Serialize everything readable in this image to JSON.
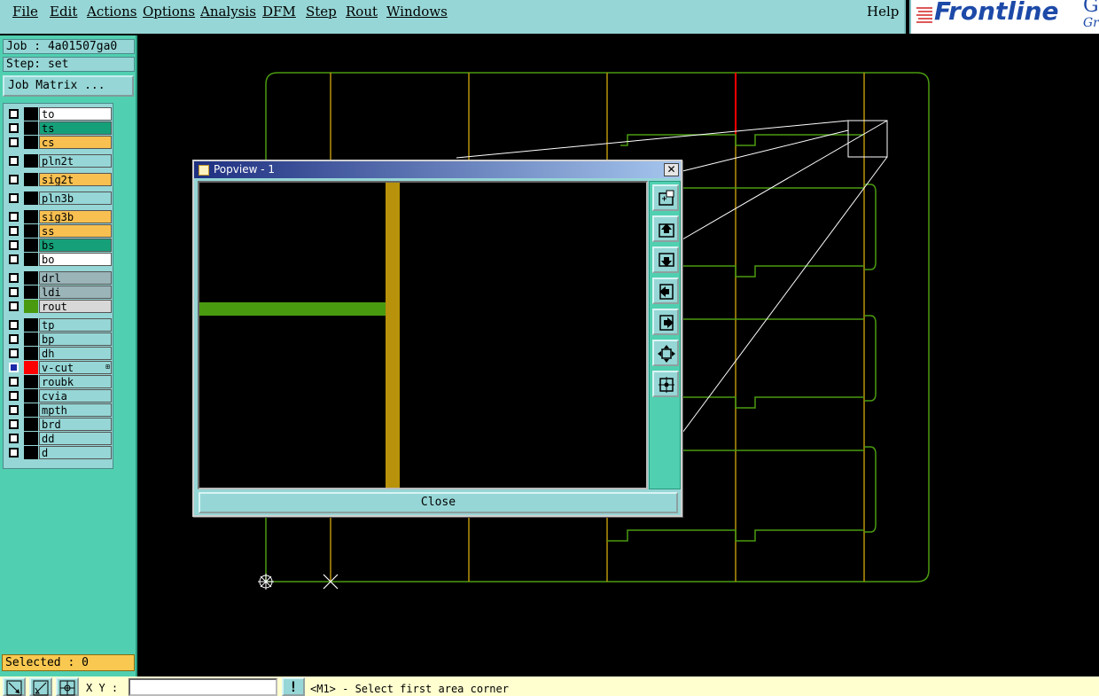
{
  "menu": {
    "items": [
      "File",
      "Edit",
      "Actions",
      "Options",
      "Analysis",
      "DFM",
      "Step",
      "Rout",
      "Windows"
    ],
    "help": "Help"
  },
  "logo": {
    "brand": "Frontline",
    "gen": "Gen",
    "gra": "Gra"
  },
  "panel": {
    "job": "Job : 4a01507ga0",
    "step": "Step: set",
    "job_matrix": "Job Matrix ...",
    "selected": "Selected : 0"
  },
  "layers": [
    {
      "name": "to",
      "color": "#ffffff",
      "swatch": "#000000",
      "checked": false
    },
    {
      "name": "ts",
      "color": "#16a07a",
      "swatch": "#000000",
      "checked": false
    },
    {
      "name": "cs",
      "color": "#f8c050",
      "swatch": "#000000",
      "checked": false
    },
    {
      "name": "pln2t",
      "color": "#96d6d6",
      "swatch": "#000000",
      "checked": false
    },
    {
      "name": "sig2t",
      "color": "#f8c050",
      "swatch": "#000000",
      "checked": false
    },
    {
      "name": "pln3b",
      "color": "#96d6d6",
      "swatch": "#000000",
      "checked": false
    },
    {
      "name": "sig3b",
      "color": "#f8c050",
      "swatch": "#000000",
      "checked": false
    },
    {
      "name": "ss",
      "color": "#f8c050",
      "swatch": "#000000",
      "checked": false
    },
    {
      "name": "bs",
      "color": "#16a07a",
      "swatch": "#000000",
      "checked": false
    },
    {
      "name": "bo",
      "color": "#ffffff",
      "swatch": "#000000",
      "checked": false
    },
    {
      "name": "drl",
      "color": "#9ab4b8",
      "swatch": "#000000",
      "checked": false
    },
    {
      "name": "ldi",
      "color": "#9ab4b8",
      "swatch": "#000000",
      "checked": false
    },
    {
      "name": "rout",
      "color": "#d8d8d8",
      "swatch": "#4a9a10",
      "checked": false
    },
    {
      "name": "tp",
      "color": "#96d6d6",
      "swatch": "#000000",
      "checked": false
    },
    {
      "name": "bp",
      "color": "#96d6d6",
      "swatch": "#000000",
      "checked": false
    },
    {
      "name": "dh",
      "color": "#96d6d6",
      "swatch": "#000000",
      "checked": false
    },
    {
      "name": "v-cut",
      "color": "#96d6d6",
      "swatch": "#ff0000",
      "checked": true
    },
    {
      "name": "roubk",
      "color": "#96d6d6",
      "swatch": "#000000",
      "checked": false
    },
    {
      "name": "cvia",
      "color": "#96d6d6",
      "swatch": "#000000",
      "checked": false
    },
    {
      "name": "mpth",
      "color": "#96d6d6",
      "swatch": "#000000",
      "checked": false
    },
    {
      "name": "brd",
      "color": "#96d6d6",
      "swatch": "#000000",
      "checked": false
    },
    {
      "name": "dd",
      "color": "#96d6d6",
      "swatch": "#000000",
      "checked": false
    },
    {
      "name": "d",
      "color": "#96d6d6",
      "swatch": "#000000",
      "checked": false
    }
  ],
  "popview": {
    "title": "Popview - 1",
    "close_x": "✕",
    "close_label": "Close",
    "tools": [
      "zoom-window-icon",
      "pan-up-icon",
      "pan-down-icon",
      "pan-left-icon",
      "pan-right-icon",
      "zoom-fit-icon",
      "zoom-home-icon"
    ]
  },
  "status": {
    "xy_label": "X Y :",
    "xy_value": "",
    "prompt": "<M1> - Select first area corner"
  },
  "colors": {
    "outline_green": "#4a9a10",
    "trace_gold": "#b8920a",
    "vcut_red": "#ff0000",
    "panel_teal": "#50d0b0",
    "menu_cyan": "#96d6d6"
  }
}
